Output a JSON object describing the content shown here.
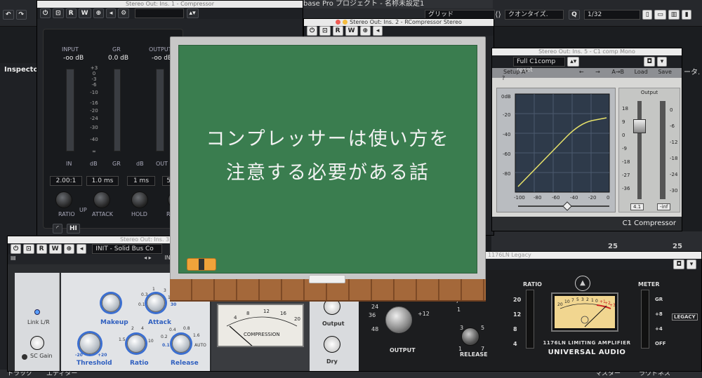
{
  "daw": {
    "title": "base Pro プロジェクト - 名称未設定1",
    "grid_label": "グリッド",
    "quantize_label": "クオンタイズ.",
    "quantize_value": "1/32",
    "inspector_label": "Inspector",
    "bottom_tabs": [
      "トラック",
      "エディター",
      "マスター",
      "ラウドネス"
    ],
    "right_cut": "ータ.",
    "meter_marks": [
      "25",
      "25"
    ]
  },
  "win_compressor": {
    "title": "Stereo Out: Ins. 1 - Compressor",
    "toolbar": [
      "R",
      "W"
    ],
    "headers": {
      "input": "INPUT",
      "gr": "GR",
      "output": "OUTPUT"
    },
    "values": {
      "input": "-oo dB",
      "gr": "0.0 dB",
      "output": "-oo dB"
    },
    "scale": [
      "+3",
      "0",
      "-3",
      "-6",
      "-10",
      "-16",
      "-20",
      "-24",
      "-30",
      "-40",
      "∞"
    ],
    "footer": {
      "in": "IN",
      "db1": "dB",
      "gr": "GR",
      "db2": "dB",
      "out": "OUT"
    },
    "params": [
      {
        "value": "2.00:1",
        "label": "RATIO"
      },
      {
        "value": "1.0 ms",
        "label": "ATTACK"
      },
      {
        "value": "1 ms",
        "label": "HOLD"
      },
      {
        "value": "500",
        "label": "RELE"
      }
    ],
    "up_label": "UP",
    "hi_label": "HI"
  },
  "win_rcomp": {
    "title": "Stereo Out: Ins. 2 - RCompressor Stereo"
  },
  "win_c1": {
    "title": "Stereo Out: Ins. 5 - C1 comp Mono",
    "preset": "Full C1comp reset",
    "setup": "Setup A*",
    "ab": "A→B",
    "load": "Load",
    "save": "Save",
    "graph_top": "0dB",
    "graph_y": [
      "-20",
      "-40",
      "-60",
      "-80"
    ],
    "graph_x": [
      "-100",
      "-80",
      "-60",
      "-40",
      "-20",
      "0"
    ],
    "output_label": "Output",
    "out_left": [
      "18",
      "9",
      "0",
      "-9",
      "-18",
      "-27",
      "-36"
    ],
    "out_right": [
      "0",
      "-6",
      "-12",
      "-18",
      "-24",
      "-30"
    ],
    "out_val": "4.1",
    "att_val": "-inf",
    "name": "C1 Compressor"
  },
  "win_ssl": {
    "title": "Stereo Out: Ins. 3",
    "preset": "INIT - Solid Bus Co",
    "preset_cut": "INI",
    "link": "Link L/R",
    "sc_gain": "SC Gain",
    "makeup": "Makeup",
    "attack": "Attack",
    "threshold": "Threshold",
    "ratio": "Ratio",
    "release": "Release",
    "attack_scale": [
      "0.3",
      "1",
      "3",
      "10",
      "30",
      "0.1"
    ],
    "ratio_scale": [
      "2",
      "4",
      "1.5",
      "10"
    ],
    "release_scale": [
      "0.4",
      "0.8",
      "0.2",
      "1.6",
      "0.1",
      "AUTO"
    ],
    "thr_scale": [
      "-20",
      "+20"
    ],
    "vu_scale": [
      "8",
      "12",
      "16",
      "20",
      "4"
    ],
    "compression": "COMPRESSION",
    "output": "Output",
    "dry": "Dry"
  },
  "win_1176": {
    "title": "1176LN Legacy",
    "output_scale": [
      "24",
      "36",
      "48",
      "+12"
    ],
    "output": "OUTPUT",
    "release": "RELEASE",
    "ratio": "RATIO",
    "ratio_vals": [
      "20",
      "12",
      "8",
      "4"
    ],
    "meter": "METER",
    "meter_vals": [
      "GR",
      "+8",
      "+4",
      "OFF"
    ],
    "vu_scale": [
      "20",
      "10",
      "7",
      "5",
      "3",
      "2",
      "1",
      "0",
      "+1",
      "+2",
      "+3"
    ],
    "brand_line": "1176LN LIMITING AMPLIFIER",
    "brand": "UNIVERSAL AUDIO",
    "legacy": "LEGACY",
    "knob_scale": [
      "7",
      "1",
      "3",
      "5",
      "1",
      "7"
    ]
  },
  "blackboard": {
    "line1": "コンプレッサーは使い方を",
    "line2": "注意する必要がある話"
  },
  "colors": {
    "board": "#3a7d4f",
    "frame": "#c7c7c7",
    "wood": "#a4683a",
    "chalk": "#f2f2f2",
    "eraser": "#f0a33a",
    "curve": "#e8e36a",
    "vu": "#f1d690",
    "ssl_panel": "#e1e3e6",
    "ssl_blue": "#2f5fbf"
  }
}
